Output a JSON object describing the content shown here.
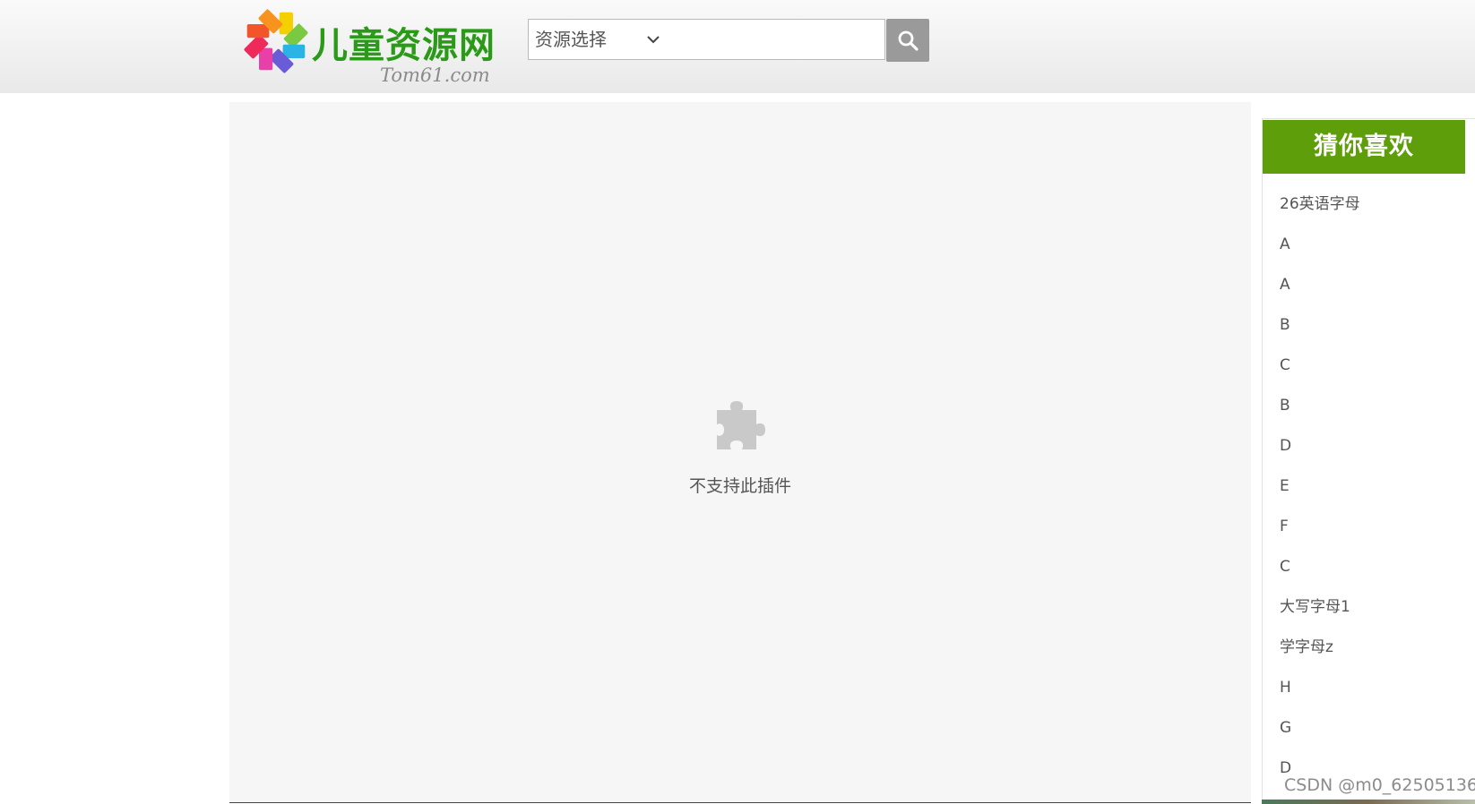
{
  "header": {
    "logo_title": "儿童资源网",
    "logo_subtitle": "Tom61.com",
    "search": {
      "select_value": "资源选择",
      "input_value": "",
      "placeholder": ""
    },
    "icons": [
      "flower-logo-icon",
      "chevron-down-icon",
      "search-icon"
    ]
  },
  "main": {
    "plugin_message": "不支持此插件",
    "icon": "puzzle-piece-icon"
  },
  "sidebar": {
    "title": "猜你喜欢",
    "accent_color": "#5e9e0a",
    "items": [
      "26英语字母",
      "A",
      "A",
      "B",
      "C",
      "B",
      "D",
      "E",
      "F",
      "C",
      "大写字母1",
      "学字母z",
      "H",
      "G",
      "D"
    ]
  },
  "watermark": "CSDN @m0_62505136"
}
